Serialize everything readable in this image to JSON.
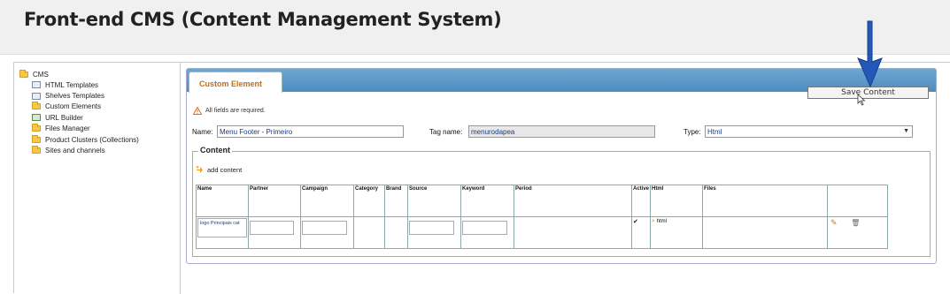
{
  "header": {
    "title": "Front-end CMS (Content Management System)"
  },
  "sidebar": {
    "root": "CMS",
    "items": [
      {
        "label": "HTML Templates",
        "icon": "template-icon"
      },
      {
        "label": "Shelves Templates",
        "icon": "template-icon"
      },
      {
        "label": "Custom Elements",
        "icon": "edit-folder-icon"
      },
      {
        "label": "URL Builder",
        "icon": "url-icon"
      },
      {
        "label": "Files Manager",
        "icon": "folder-icon"
      },
      {
        "label": "Product Clusters (Collections)",
        "icon": "folder-icon"
      },
      {
        "label": "Sites and channels",
        "icon": "folder-icon"
      }
    ]
  },
  "panel": {
    "tab_label": "Custom Element",
    "save_label": "Save Content",
    "warning": "All fields are required.",
    "name_label": "Name:",
    "name_value": "Menu Footer - Primeiro",
    "tag_label": "Tag name:",
    "tag_value": "menurodapea",
    "type_label": "Type:",
    "type_value": "Html",
    "content_legend": "Content",
    "add_content": "add content"
  },
  "table": {
    "columns": [
      "Name",
      "Partner",
      "Campaign",
      "Category",
      "Brand",
      "Source",
      "Keyword",
      "Period",
      "Active",
      "Html",
      "Files",
      ""
    ],
    "row": {
      "name": "logo Principais cat",
      "active": "✔",
      "html": "html"
    }
  },
  "colors": {
    "accent_blue": "#4d8cc0",
    "tab_text": "#c0701a",
    "arrow": "#2458b8"
  }
}
